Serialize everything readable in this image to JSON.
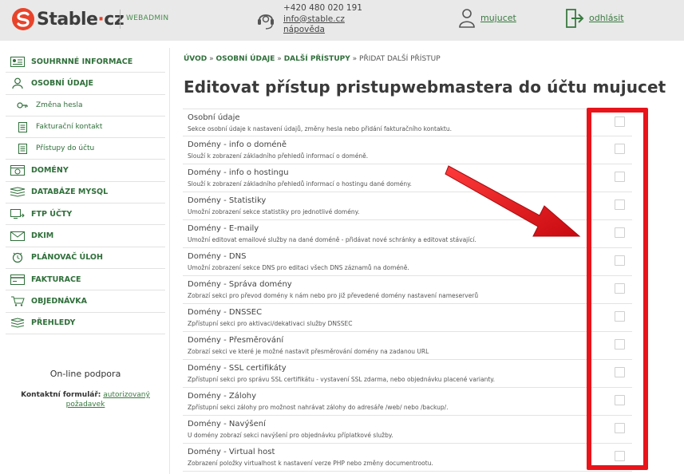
{
  "header": {
    "logo_text": "Stable",
    "logo_dot": "·",
    "logo_tld": "cz",
    "logo_icon": "stable-s-logo-icon",
    "webadmin": "WEBADMIN",
    "phone": "+420 480 020 191",
    "email": "info@stable.cz",
    "help": "nápověda",
    "user": "mujucet",
    "logout": "odhlásit",
    "icons": [
      "headset-icon",
      "user-icon",
      "logout-icon"
    ]
  },
  "sidebar": {
    "items": [
      {
        "label": "SOUHRNNÉ INFORMACE",
        "icon": "id-card-icon"
      },
      {
        "label": "OSOBNÍ ÚDAJE",
        "icon": "person-icon"
      },
      {
        "label": "Změna hesla",
        "icon": "key-icon",
        "sub": true
      },
      {
        "label": "Fakturační kontakt",
        "icon": "document-icon",
        "sub": true
      },
      {
        "label": "Přístupy do účtu",
        "icon": "document-icon",
        "sub": true
      },
      {
        "label": "DOMÉNY",
        "icon": "globe-window-icon"
      },
      {
        "label": "DATABÁZE MYSQL",
        "icon": "database-icon"
      },
      {
        "label": "FTP ÚČTY",
        "icon": "ftp-icon"
      },
      {
        "label": "DKIM",
        "icon": "dkim-icon"
      },
      {
        "label": "PLÁNOVAČ ÚLOH",
        "icon": "scheduler-icon"
      },
      {
        "label": "FAKTURACE",
        "icon": "invoice-icon"
      },
      {
        "label": "OBJEDNÁVKA",
        "icon": "order-icon"
      },
      {
        "label": "PŘEHLEDY",
        "icon": "overview-icon"
      }
    ],
    "support_title": "On-line podpora",
    "support_label": "Kontaktní formulář:",
    "support_link": "autorizovaný požadavek"
  },
  "breadcrumb": {
    "items": [
      "ÚVOD",
      "OSOBNÍ ÚDAJE",
      "DALŠÍ PŘÍSTUPY"
    ],
    "separator": "»",
    "current": "PŘIDAT DALŠÍ PŘÍSTUP"
  },
  "title": "Editovat přístup pristupwebmastera do účtu mujucet",
  "permissions": [
    {
      "title": "Osobní údaje",
      "desc": "Sekce osobní údaje k nastavení údajů, změny hesla nebo přidání fakturačního kontaktu.",
      "checked": false
    },
    {
      "title": "Domény - info o doméně",
      "desc": "Slouží k zobrazení základního přehledů informací o doméně.",
      "checked": false
    },
    {
      "title": "Domény - info o hostingu",
      "desc": "Slouží k zobrazení základního přehledů informací o hostingu dané domény.",
      "checked": false
    },
    {
      "title": "Domény - Statistiky",
      "desc": "Umožní zobrazení sekce statistiky pro jednotlivé domény.",
      "checked": false
    },
    {
      "title": "Domény - E-maily",
      "desc": "Umožní editovat emailové služby na dané doméně - přidávat nové schránky a editovat stávající.",
      "checked": false
    },
    {
      "title": "Domény - DNS",
      "desc": "Umožní zobrazení sekce DNS pro editaci všech DNS záznamů na doméně.",
      "checked": false
    },
    {
      "title": "Domény - Správa domény",
      "desc": "Zobrazí sekci pro převod domény k nám nebo pro již převedené domény nastavení nameserverů",
      "checked": false
    },
    {
      "title": "Domény - DNSSEC",
      "desc": "Zpřístupní sekci pro aktivaci/dekativaci služby DNSSEC",
      "checked": false
    },
    {
      "title": "Domény - Přesměrování",
      "desc": "Zobrazí sekci ve které je možné nastavit přesměrování domény na zadanou URL",
      "checked": false
    },
    {
      "title": "Domény - SSL certifikáty",
      "desc": "Zpřístupní sekci pro správu SSL certifikátu - vystavení SSL zdarma, nebo objednávku placené varianty.",
      "checked": false
    },
    {
      "title": "Domény - Zálohy",
      "desc": "Zpřístupní sekci zálohy pro možnost nahrávat zálohy do adresáře /web/ nebo /backup/.",
      "checked": false
    },
    {
      "title": "Domény - Navýšení",
      "desc": "U domény zobrazí sekci navýšení pro objednávku příplatkové služby.",
      "checked": false
    },
    {
      "title": "Domény - Virtual host",
      "desc": "Zobrazení položky virtualhost k nastavení verze PHP nebo změny documentrootu.",
      "checked": false
    }
  ],
  "colors": {
    "accent_green": "#2f6f3a",
    "logo_red": "#e8442b",
    "highlight_red": "#e8141a",
    "header_bg": "#e9e9e9"
  }
}
